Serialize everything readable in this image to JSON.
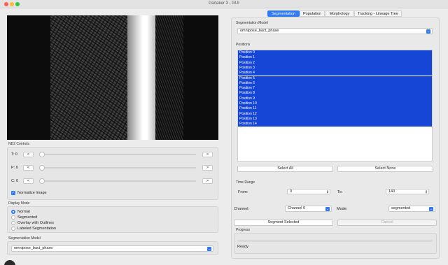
{
  "window": {
    "title": "Partaker 3 - GUI"
  },
  "left": {
    "nd2_controls_label": "ND2 Controls",
    "controls": [
      {
        "label": "T: 0",
        "prev": "<",
        "next": ">",
        "value": 0
      },
      {
        "label": "P: 0",
        "prev": "<",
        "next": ">",
        "value": 0
      },
      {
        "label": "C: 0",
        "prev": "<",
        "next": ">",
        "value": 0
      }
    ],
    "normalize_label": "Normalize Image",
    "normalize_checked": true,
    "display_mode_label": "Display Mode",
    "display_modes": [
      "Normal",
      "Segmented",
      "Overlay with Outlines",
      "Labeled Segmentation"
    ],
    "display_mode_selected": "Normal",
    "segmentation_model_label": "Segmentation Model",
    "segmentation_model_value": "omnipose_bact_phase"
  },
  "tabs": [
    "Segmentation",
    "Population",
    "Morphology",
    "Tracking - Lineage Tree"
  ],
  "active_tab": "Segmentation",
  "right": {
    "segmentation_model_label": "Segmentation Model",
    "segmentation_model_value": "omnipose_bact_phase",
    "positions_label": "Positions",
    "positions": [
      "Position 0",
      "Position 1",
      "Position 2",
      "Position 3",
      "Position 4",
      "Position 5",
      "Position 6",
      "Position 7",
      "Position 8",
      "Position 9",
      "Position 10",
      "Position 11",
      "Position 12",
      "Position 13",
      "Position 14"
    ],
    "select_all": "Select All",
    "select_none": "Select None",
    "time_range_label": "Time Range",
    "from_label": "From:",
    "from_value": "0",
    "to_label": "To:",
    "to_value": "140",
    "channel_label": "Channel:",
    "channel_value": "Channel 0",
    "mode_label": "Mode:",
    "mode_value": "segmented",
    "segment_button": "Segment Selected",
    "cancel_button": "Cancel",
    "progress_label": "Progress",
    "progress_value": 0,
    "status": "Ready"
  },
  "colors": {
    "accent": "#2f7bf5",
    "selection": "#1546d6"
  }
}
